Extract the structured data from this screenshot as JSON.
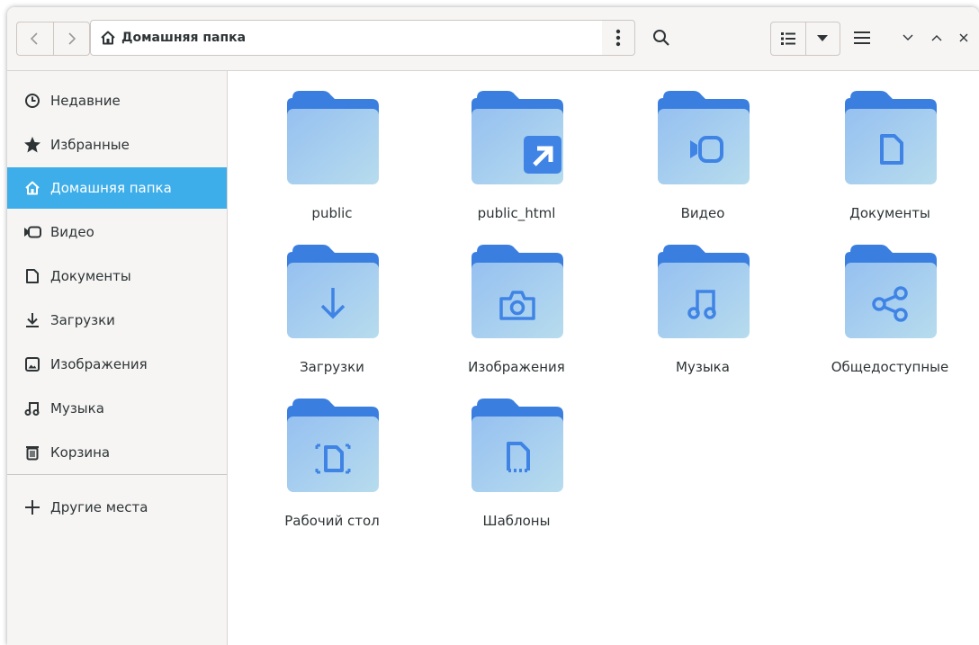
{
  "header": {
    "path_label": "Домашняя папка"
  },
  "sidebar": {
    "items": [
      {
        "label": "Недавние",
        "icon": "clock-icon"
      },
      {
        "label": "Избранные",
        "icon": "star-icon"
      },
      {
        "label": "Домашняя папка",
        "icon": "home-icon",
        "active": true
      },
      {
        "label": "Видео",
        "icon": "video-icon"
      },
      {
        "label": "Документы",
        "icon": "document-icon"
      },
      {
        "label": "Загрузки",
        "icon": "download-icon"
      },
      {
        "label": "Изображения",
        "icon": "image-icon"
      },
      {
        "label": "Музыка",
        "icon": "music-icon"
      },
      {
        "label": "Корзина",
        "icon": "trash-icon"
      }
    ],
    "other_places": "Другие места"
  },
  "files": [
    {
      "label": "public",
      "emblem": "none"
    },
    {
      "label": "public_html",
      "emblem": "symlink-arrow-icon"
    },
    {
      "label": "Видео",
      "emblem": "video-icon"
    },
    {
      "label": "Документы",
      "emblem": "document-icon"
    },
    {
      "label": "Загрузки",
      "emblem": "download-icon"
    },
    {
      "label": "Изображения",
      "emblem": "camera-icon"
    },
    {
      "label": "Музыка",
      "emblem": "music-icon"
    },
    {
      "label": "Общедоступные",
      "emblem": "share-icon"
    },
    {
      "label": "Рабочий стол",
      "emblem": "desktop-icon"
    },
    {
      "label": "Шаблоны",
      "emblem": "template-icon"
    }
  ],
  "colors": {
    "accent": "#3daee9",
    "folder_tab": "#3a7fe0",
    "folder_body": "#a8cef2",
    "emblem": "#3f84e5"
  }
}
